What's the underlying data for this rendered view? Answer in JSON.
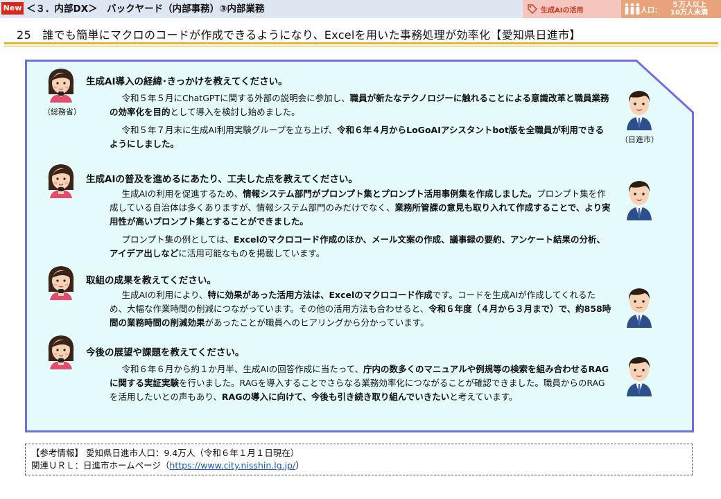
{
  "header": {
    "new_badge": "New",
    "section": "＜３．内部DX＞　バックヤード（内部事務）③内部業務",
    "tag_ai": "生成AIの活用",
    "tag_pop_label": "人口：",
    "tag_pop_value_1": "５万人以上",
    "tag_pop_value_2": "10万人未満"
  },
  "headline": "25　誰でも簡単にマクロのコードが作成できるようになり、Excelを用いた事務処理が効率化【愛知県日進市】",
  "labels": {
    "interviewer": "（総務省）",
    "respondent": "（日進市）"
  },
  "qa": [
    {
      "question": "生成AI導入の経緯･きっかけを教えてください。",
      "paragraphs": [
        [
          {
            "t": "令和５年５月にChatGPTに関する外部の説明会に参加し、",
            "b": false
          },
          {
            "t": "職員が新たなテクノロジーに触れることによる意識改革と職員業務の効率化を目的",
            "b": true
          },
          {
            "t": "として導入を検討し始めました。",
            "b": false
          }
        ],
        [
          {
            "t": "令和５年７月末に生成AI利用実験グループを立ち上げ、",
            "b": false
          },
          {
            "t": "令和６年４月からLoGoAIアシスタントbot版を全職員が利用できるようにしました。",
            "b": true
          }
        ]
      ]
    },
    {
      "question": "生成AIの普及を進めるにあたり、工夫した点を教えてください。",
      "paragraphs": [
        [
          {
            "t": "生成AIの利用を促進するため、",
            "b": false
          },
          {
            "t": "情報システム部門がプロンプト集とプロンプト活用事例集を作成しました。",
            "b": true
          },
          {
            "t": "プロンプト集を作成している自治体は多くありますが、情報システム部門のみだけでなく、",
            "b": false
          },
          {
            "t": "業務所管課の意見も取り入れて作成することで、より実用性が高いプロンプト集とすることができました。",
            "b": true
          }
        ],
        [
          {
            "t": "プロンプト集の例としては、",
            "b": false
          },
          {
            "t": "Excelのマクロコード作成のほか、メール文案の作成、議事録の要約、アンケート結果の分析、アイデア出しなど",
            "b": true
          },
          {
            "t": "に活用可能なものを掲載しています。",
            "b": false
          }
        ]
      ]
    },
    {
      "question": "取組の成果を教えてください。",
      "paragraphs": [
        [
          {
            "t": "生成AIの利用により、",
            "b": false
          },
          {
            "t": "特に効果があった活用方法は、Excelのマクロコード作成",
            "b": true
          },
          {
            "t": "です。コードを生成AIが作成してくれるため、大幅な作業時間の削減につながっています。その他の活用方法も合わせると、",
            "b": false
          },
          {
            "t": "令和６年度（４月から３月まで）で、約858時間の業務時間の削減効果",
            "b": true
          },
          {
            "t": "があったことが職員へのヒアリングから分かっています。",
            "b": false
          }
        ]
      ]
    },
    {
      "question": "今後の展望や課題を教えてください。",
      "paragraphs": [
        [
          {
            "t": "令和６年６月から約１か月半、生成AIの回答作成に当たって、",
            "b": false
          },
          {
            "t": "庁内の数多くのマニュアルや例規等の検索を組み合わせるRAGに関する実証実験",
            "b": true
          },
          {
            "t": "を行いました。RAGを導入することでさらなる業務効率化につながることが確認できました。職員からのRAGを活用したいとの声もあり、",
            "b": false
          },
          {
            "t": "RAGの導入に向けて、今後も引き続き取り組んでいきたい",
            "b": true
          },
          {
            "t": "と考えています。",
            "b": false
          }
        ]
      ]
    }
  ],
  "reference": {
    "line1": "【参考情報】 愛知県日進市人口：9.4万人（令和６年１月１日現在）",
    "line2_prefix": "関連ＵＲＬ：日進市ホームページ（",
    "link": "https://www.city.nisshin.lg.jp/",
    "line2_suffix": "）"
  },
  "colors": {
    "panel_fill": "#e5fbfb",
    "panel_border": "#6f6fe0",
    "gold_rule": "#e9b530",
    "new_badge": "#d9271a",
    "tag_ai_bg": "#f4c6bd",
    "tag_pop_bg": "#e8a37a",
    "header_bg": "#dde6f1"
  },
  "icons": {
    "interviewer": "woman-avatar-icon",
    "respondent": "man-avatar-icon",
    "tag_ai": "tag-icon",
    "tag_pop": "people-icon"
  }
}
